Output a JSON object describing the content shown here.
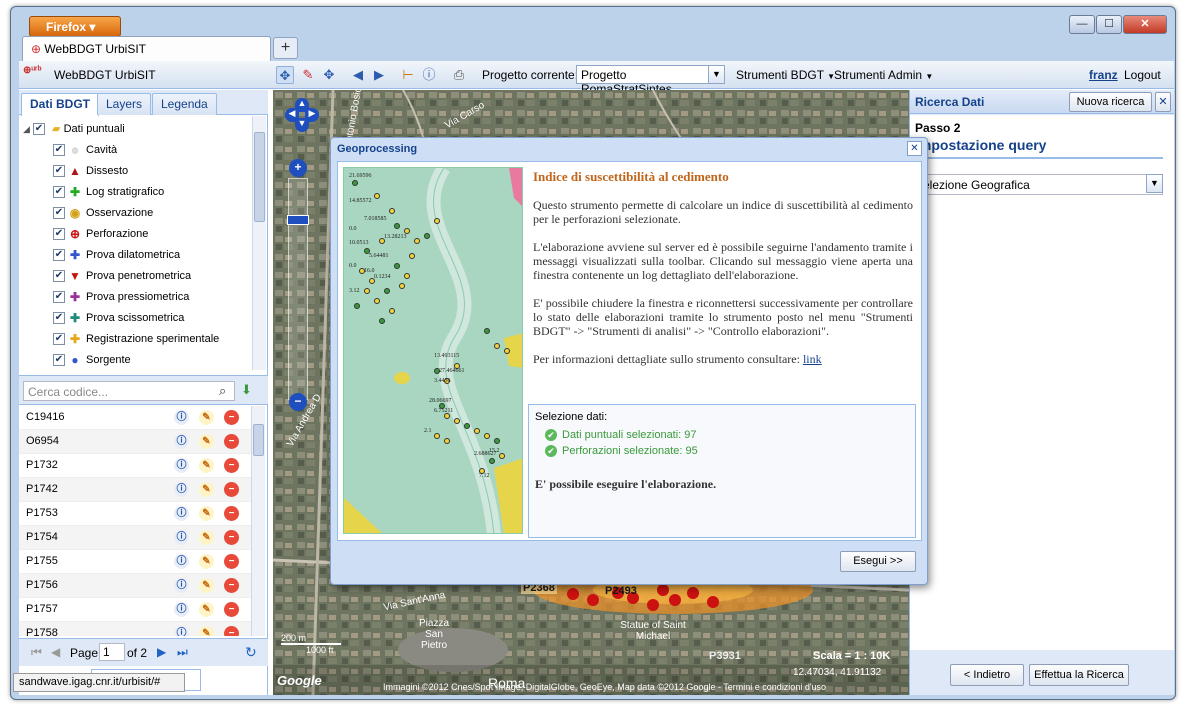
{
  "browser": {
    "menu_label": "Firefox",
    "tab_title": "WebBDGT UrbiSIT",
    "status_url": "sandwave.igag.cnr.it/urbisit/#"
  },
  "app": {
    "title": "WebBDGT UrbiSIT",
    "project_label": "Progetto corrente:",
    "project_value": "Progetto RomaStratSintes",
    "menu_strumenti_bdgt": "Strumenti BDGT",
    "menu_strumenti_admin": "Strumenti Admin",
    "user": "franz",
    "logout": "Logout"
  },
  "left_panel": {
    "tabs": [
      "Dati BDGT",
      "Layers",
      "Legenda"
    ],
    "tree_root": "Dati puntuali",
    "layers": [
      {
        "label": "Cavità",
        "color": "#cccccc",
        "symbol": "circle"
      },
      {
        "label": "Dissesto",
        "color": "#b01515",
        "symbol": "triangle"
      },
      {
        "label": "Log stratigrafico",
        "color": "#22aa22",
        "symbol": "plus"
      },
      {
        "label": "Osservazione",
        "color": "#d4a017",
        "symbol": "dot-circle"
      },
      {
        "label": "Perforazione",
        "color": "#cc1111",
        "symbol": "plus-circle"
      },
      {
        "label": "Prova dilatometrica",
        "color": "#3355cc",
        "symbol": "plus"
      },
      {
        "label": "Prova penetrometrica",
        "color": "#cc1111",
        "symbol": "down-triangle"
      },
      {
        "label": "Prova pressiometrica",
        "color": "#993399",
        "symbol": "plus"
      },
      {
        "label": "Prova scissometrica",
        "color": "#1f8a7a",
        "symbol": "plus"
      },
      {
        "label": "Registrazione sperimentale",
        "color": "#e6a817",
        "symbol": "plus"
      },
      {
        "label": "Sorgente",
        "color": "#3355cc",
        "symbol": "circle"
      }
    ],
    "search_placeholder": "Cerca codice...",
    "codes": [
      "C19416",
      "O6954",
      "P1732",
      "P1742",
      "P1753",
      "P1754",
      "P1755",
      "P1756",
      "P1757",
      "P1758"
    ],
    "pager": {
      "page_label": "Page",
      "page_value": "1",
      "of_label": "of 2"
    },
    "bottom_tab": "ricerca"
  },
  "map": {
    "labels": [
      "Via Andrea D",
      "Via Sant'Anna",
      "Piazza San Pietro",
      "Roma",
      "Statue of Saint Michael",
      "P2368",
      "P2493",
      "P3931",
      "Via Carso",
      "Via Antonio Bosio"
    ],
    "scale_m": "200 m",
    "scale_ft": "1000 ft",
    "scale_label": "Scala = 1 : 10K",
    "coords": "12.47034, 41.91132",
    "attribution": "Immagini ©2012 Cnes/Spot Image, DigitalGlobe, GeoEye, Map data ©2012 Google - Termini e condizioni d'uso",
    "logo": "Google"
  },
  "right_panel": {
    "title": "Ricerca Dati",
    "new_search": "Nuova ricerca",
    "step": "Passo 2",
    "heading": "Impostazione query",
    "select_value": "Selezione Geografica",
    "back_button": "< Indietro",
    "run_button": "Effettua la Ricerca"
  },
  "dialog": {
    "title": "Geoprocessing",
    "heading": "Indice di suscettibilità al cedimento",
    "para1": "Questo strumento permette di calcolare un indice di suscettibilità al cedimento per le perforazioni selezionate.",
    "para2": "L'elaborazione avviene sul server ed è possibile seguirne l'andamento tramite i messaggi visualizzati sulla toolbar. Clicando sul messaggio viene aperta una finestra contenente un log dettagliato dell'elaborazione.",
    "para3": "E' possibile chiudere la finestra e riconnettersi successivamente per controllare lo stato delle elaborazioni tramite lo strumento posto nel menu \"Strumenti BDGT\" -> \"Strumenti di analisi\" -> \"Controllo elaborazioni\".",
    "para4_prefix": "Per informazioni dettagliate sullo strumento consultare:",
    "link": "link",
    "selection_title": "Selezione dati:",
    "sel_points": "Dati puntuali selezionati: 97",
    "sel_drills": "Perforazioni selezionate: 95",
    "can_run": "E' possibile eseguire l'elaborazione.",
    "run_button": "Esegui >>",
    "mini_map_labels": [
      "21.69596",
      "14.85572",
      "7.018585",
      "0.0",
      "10.0513",
      "13.28213",
      "5.64481",
      "0.0",
      "16.0",
      "0.1234",
      "13.493115",
      "27.464661",
      "3.4436",
      "28.06697",
      "6.75211",
      "2.688627",
      "7.12",
      "15.2",
      "3.12",
      "2.1"
    ]
  }
}
